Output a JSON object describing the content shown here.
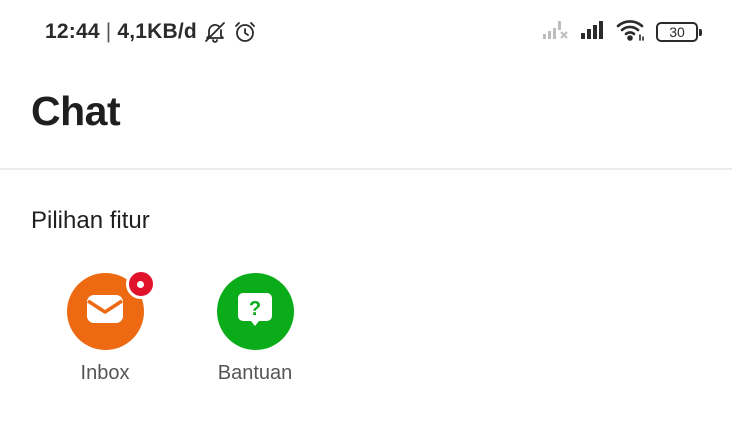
{
  "status_bar": {
    "time": "12:44",
    "separator": "|",
    "network_speed": "4,1KB/d",
    "battery_level": "30",
    "icons": [
      "bell-muted-icon",
      "alarm-clock-icon",
      "signal-no-service-icon",
      "signal-strength-icon",
      "wifi-icon",
      "battery-icon"
    ]
  },
  "header": {
    "title": "Chat"
  },
  "features_section": {
    "title": "Pilihan fitur",
    "items": [
      {
        "label": "Inbox",
        "icon": "mail-icon",
        "color": "#ee6a12",
        "has_badge": true
      },
      {
        "label": "Bantuan",
        "icon": "help-chat-icon",
        "color": "#0aad19",
        "has_badge": false
      }
    ]
  },
  "colors": {
    "inbox_orange": "#ee6a12",
    "help_green": "#0aad19",
    "badge_red": "#e0122c",
    "divider": "#ececec"
  }
}
